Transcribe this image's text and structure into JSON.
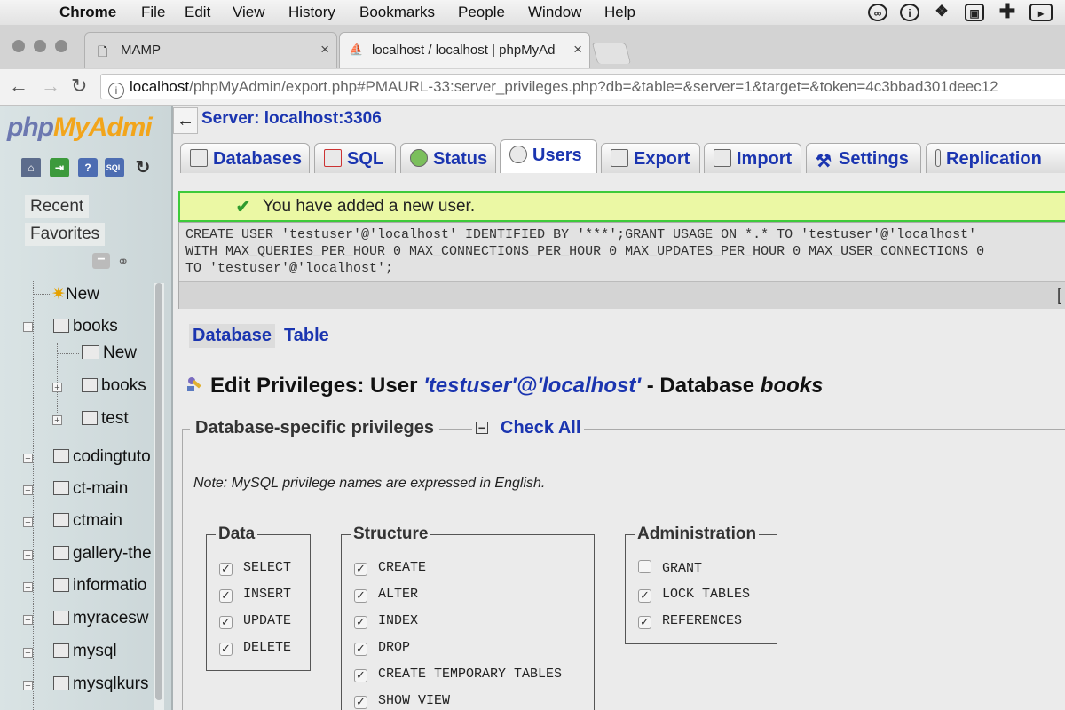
{
  "menubar": {
    "app": "Chrome",
    "items": [
      "File",
      "Edit",
      "View",
      "History",
      "Bookmarks",
      "People",
      "Window",
      "Help"
    ]
  },
  "tabs": [
    {
      "label": "MAMP",
      "close": "×"
    },
    {
      "label": "localhost / localhost | phpMyAd",
      "close": "×"
    }
  ],
  "address": {
    "host": "localhost",
    "path": "/phpMyAdmin/export.php#PMAURL-33:server_privileges.php?db=&table=&server=1&target=&token=4c3bbad301deec12"
  },
  "sidebar": {
    "logo_a": "php",
    "logo_b": "MyAdmi",
    "recent": "Recent",
    "favorites": "Favorites",
    "tree": [
      {
        "label": "New",
        "level": 0
      },
      {
        "label": "books",
        "level": 0
      },
      {
        "label": "New",
        "level": 1
      },
      {
        "label": "books",
        "level": 1
      },
      {
        "label": "test",
        "level": 1
      },
      {
        "label": "codingtuto",
        "level": 0
      },
      {
        "label": "ct-main",
        "level": 0
      },
      {
        "label": "ctmain",
        "level": 0
      },
      {
        "label": "gallery-the",
        "level": 0
      },
      {
        "label": "informatio",
        "level": 0
      },
      {
        "label": "myracesw",
        "level": 0
      },
      {
        "label": "mysql",
        "level": 0
      },
      {
        "label": "mysqlkurs",
        "level": 0
      }
    ]
  },
  "server": {
    "label": "Server: localhost:3306"
  },
  "pma_tabs": [
    {
      "label": "Databases"
    },
    {
      "label": "SQL"
    },
    {
      "label": "Status"
    },
    {
      "label": "Users"
    },
    {
      "label": "Export"
    },
    {
      "label": "Import"
    },
    {
      "label": "Settings"
    },
    {
      "label": "Replication"
    }
  ],
  "message": "You have added a new user.",
  "sql": {
    "line1": "CREATE USER 'testuser'@'localhost' IDENTIFIED BY '***';GRANT USAGE ON *.* TO 'testuser'@'localhost'",
    "line2": "WITH MAX_QUERIES_PER_HOUR 0 MAX_CONNECTIONS_PER_HOUR 0 MAX_UPDATES_PER_HOUR 0 MAX_USER_CONNECTIONS 0",
    "line3": "TO 'testuser'@'localhost';",
    "bracket": "["
  },
  "subnav": {
    "database": "Database",
    "table": "Table"
  },
  "heading": {
    "prefix": "Edit Privileges: User ",
    "user": "'testuser'@'localhost'",
    "mid": " - Database ",
    "db": "books"
  },
  "privileges": {
    "legend": "Database-specific privileges",
    "check_all": "Check All",
    "note": "Note: MySQL privilege names are expressed in English.",
    "groups": [
      {
        "title": "Data",
        "items": [
          {
            "name": "SELECT",
            "checked": true
          },
          {
            "name": "INSERT",
            "checked": true
          },
          {
            "name": "UPDATE",
            "checked": true
          },
          {
            "name": "DELETE",
            "checked": true
          }
        ]
      },
      {
        "title": "Structure",
        "items": [
          {
            "name": "CREATE",
            "checked": true
          },
          {
            "name": "ALTER",
            "checked": true
          },
          {
            "name": "INDEX",
            "checked": true
          },
          {
            "name": "DROP",
            "checked": true
          },
          {
            "name": "CREATE TEMPORARY TABLES",
            "checked": true
          },
          {
            "name": "SHOW VIEW",
            "checked": true
          }
        ]
      },
      {
        "title": "Administration",
        "items": [
          {
            "name": "GRANT",
            "checked": false
          },
          {
            "name": "LOCK TABLES",
            "checked": true
          },
          {
            "name": "REFERENCES",
            "checked": true
          }
        ]
      }
    ]
  }
}
